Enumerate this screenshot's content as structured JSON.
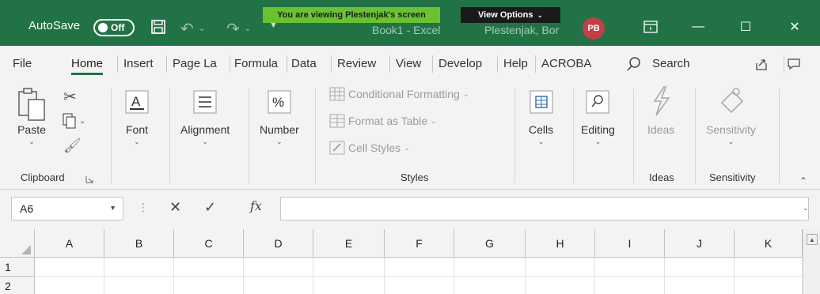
{
  "titlebar": {
    "autosave_label": "AutoSave",
    "autosave_state": "Off",
    "banner_text": "You are viewing Plestenjak's screen",
    "view_options_label": "View Options",
    "document_title": "Book1  -  Excel",
    "user_name": "Plestenjak, Bor",
    "user_initials": "PB",
    "minimize_glyph": "—",
    "maximize_glyph": "☐",
    "close_glyph": "✕",
    "brand_color": "#217346"
  },
  "tabs": {
    "items": [
      "File",
      "Home",
      "Insert",
      "Page La",
      "Formula",
      "Data",
      "Review",
      "View",
      "Develop",
      "Help",
      "ACROBA"
    ],
    "active": "Home",
    "search_label": "Search"
  },
  "ribbon": {
    "clipboard": {
      "paste_label": "Paste",
      "group_label": "Clipboard"
    },
    "font_label": "Font",
    "alignment_label": "Alignment",
    "number_label": "Number",
    "styles": {
      "conditional_formatting": "Conditional Formatting",
      "format_as_table": "Format as Table",
      "cell_styles": "Cell Styles",
      "group_label": "Styles"
    },
    "cells_label": "Cells",
    "editing_label": "Editing",
    "ideas": {
      "button_label": "Ideas",
      "group_label": "Ideas"
    },
    "sensitivity": {
      "button_label": "Sensitivity",
      "group_label": "Sensitivity"
    }
  },
  "formula_bar": {
    "name_box_value": "A6",
    "formula_value": ""
  },
  "grid": {
    "columns": [
      "A",
      "B",
      "C",
      "D",
      "E",
      "F",
      "G",
      "H",
      "I",
      "J",
      "K"
    ],
    "rows": [
      "1",
      "2"
    ]
  }
}
